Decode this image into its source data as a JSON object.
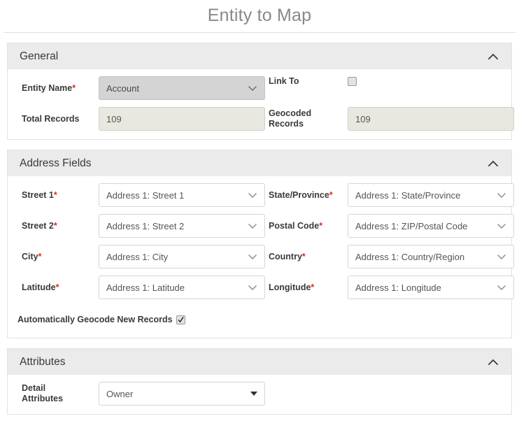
{
  "page": {
    "title": "Entity to Map"
  },
  "icons": {
    "collapse": "chevron-up-icon",
    "dropdown": "chevron-down-icon",
    "dropdown_solid": "triangle-down-icon"
  },
  "colors": {
    "required_asterisk": "#e02b20",
    "section_header_bg": "#ebebeb",
    "readonly_field_bg": "#e9e8e0",
    "disabled_field_bg": "#d4d4d4",
    "title_text": "#888888"
  },
  "sections": {
    "general": {
      "header": "General",
      "fields": {
        "entity_name": {
          "label": "Entity Name",
          "required": true,
          "value": "Account",
          "state": "disabled"
        },
        "link_to": {
          "label": "Link To",
          "required": false,
          "checked": false
        },
        "total_records": {
          "label": "Total Records",
          "required": false,
          "value": "109",
          "state": "readonly"
        },
        "geocoded_records": {
          "label": "Geocoded Records",
          "label_line1": "Geocoded",
          "label_line2": "Records",
          "required": false,
          "value": "109",
          "state": "readonly"
        }
      }
    },
    "address_fields": {
      "header": "Address Fields",
      "fields": {
        "street1": {
          "label": "Street 1",
          "required": true,
          "value": "Address 1: Street 1"
        },
        "street2": {
          "label": "Street 2",
          "required": true,
          "value": "Address 1: Street 2"
        },
        "city": {
          "label": "City",
          "required": true,
          "value": "Address 1: City"
        },
        "latitude": {
          "label": "Latitude",
          "required": true,
          "value": "Address 1: Latitude"
        },
        "state_province": {
          "label": "State/Province",
          "required": true,
          "value": "Address 1: State/Province"
        },
        "postal_code": {
          "label": "Postal Code",
          "required": true,
          "value": "Address 1: ZIP/Postal Code"
        },
        "country": {
          "label": "Country",
          "required": true,
          "value": "Address 1: Country/Region"
        },
        "longitude": {
          "label": "Longitude",
          "required": true,
          "value": "Address 1: Longitude"
        },
        "auto_geocode": {
          "label": "Automatically Geocode New Records",
          "checked": true
        }
      }
    },
    "attributes": {
      "header": "Attributes",
      "fields": {
        "detail_attributes": {
          "label": "Detail Attributes",
          "label_line1": "Detail",
          "label_line2": "Attributes",
          "required": false,
          "value": "Owner"
        }
      }
    }
  }
}
